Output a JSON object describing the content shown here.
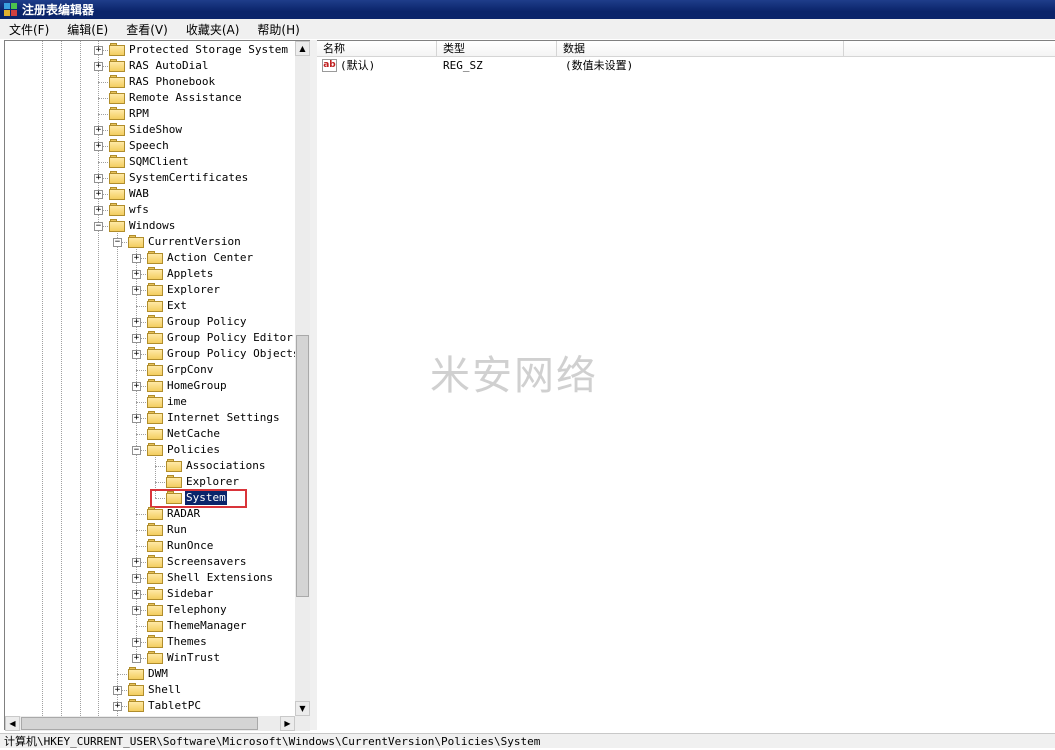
{
  "window": {
    "title": "注册表编辑器"
  },
  "menu": [
    "文件(F)",
    "编辑(E)",
    "查看(V)",
    "收藏夹(A)",
    "帮助(H)"
  ],
  "tree": [
    {
      "label": "Protected Storage System Pro",
      "level": 0,
      "expander": "+"
    },
    {
      "label": "RAS AutoDial",
      "level": 0,
      "expander": "+"
    },
    {
      "label": "RAS Phonebook",
      "level": 0,
      "expander": ""
    },
    {
      "label": "Remote Assistance",
      "level": 0,
      "expander": ""
    },
    {
      "label": "RPM",
      "level": 0,
      "expander": ""
    },
    {
      "label": "SideShow",
      "level": 0,
      "expander": "+"
    },
    {
      "label": "Speech",
      "level": 0,
      "expander": "+"
    },
    {
      "label": "SQMClient",
      "level": 0,
      "expander": ""
    },
    {
      "label": "SystemCertificates",
      "level": 0,
      "expander": "+"
    },
    {
      "label": "WAB",
      "level": 0,
      "expander": "+"
    },
    {
      "label": "wfs",
      "level": 0,
      "expander": "+"
    },
    {
      "label": "Windows",
      "level": 0,
      "expander": "-"
    },
    {
      "label": "CurrentVersion",
      "level": 1,
      "expander": "-"
    },
    {
      "label": "Action Center",
      "level": 2,
      "expander": "+"
    },
    {
      "label": "Applets",
      "level": 2,
      "expander": "+"
    },
    {
      "label": "Explorer",
      "level": 2,
      "expander": "+"
    },
    {
      "label": "Ext",
      "level": 2,
      "expander": ""
    },
    {
      "label": "Group Policy",
      "level": 2,
      "expander": "+"
    },
    {
      "label": "Group Policy Editor",
      "level": 2,
      "expander": "+"
    },
    {
      "label": "Group Policy Objects",
      "level": 2,
      "expander": "+"
    },
    {
      "label": "GrpConv",
      "level": 2,
      "expander": ""
    },
    {
      "label": "HomeGroup",
      "level": 2,
      "expander": "+"
    },
    {
      "label": "ime",
      "level": 2,
      "expander": ""
    },
    {
      "label": "Internet Settings",
      "level": 2,
      "expander": "+"
    },
    {
      "label": "NetCache",
      "level": 2,
      "expander": ""
    },
    {
      "label": "Policies",
      "level": 2,
      "expander": "-"
    },
    {
      "label": "Associations",
      "level": 3,
      "expander": ""
    },
    {
      "label": "Explorer",
      "level": 3,
      "expander": ""
    },
    {
      "label": "System",
      "level": 3,
      "expander": "",
      "selected": true
    },
    {
      "label": "RADAR",
      "level": 2,
      "expander": ""
    },
    {
      "label": "Run",
      "level": 2,
      "expander": ""
    },
    {
      "label": "RunOnce",
      "level": 2,
      "expander": ""
    },
    {
      "label": "Screensavers",
      "level": 2,
      "expander": "+"
    },
    {
      "label": "Shell Extensions",
      "level": 2,
      "expander": "+"
    },
    {
      "label": "Sidebar",
      "level": 2,
      "expander": "+"
    },
    {
      "label": "Telephony",
      "level": 2,
      "expander": "+"
    },
    {
      "label": "ThemeManager",
      "level": 2,
      "expander": ""
    },
    {
      "label": "Themes",
      "level": 2,
      "expander": "+"
    },
    {
      "label": "WinTrust",
      "level": 2,
      "expander": "+"
    },
    {
      "label": "DWM",
      "level": 1,
      "expander": ""
    },
    {
      "label": "Shell",
      "level": 1,
      "expander": "+"
    },
    {
      "label": "TabletPC",
      "level": 1,
      "expander": "+"
    }
  ],
  "list": {
    "columns": [
      "名称",
      "类型",
      "数据"
    ],
    "rows": [
      {
        "name": "(默认)",
        "type": "REG_SZ",
        "data": "(数值未设置)",
        "icon": "string-value-icon"
      }
    ]
  },
  "watermark": "米安网络",
  "status": {
    "path": "计算机\\HKEY_CURRENT_USER\\Software\\Microsoft\\Windows\\CurrentVersion\\Policies\\System"
  },
  "colors": {
    "titlebar": "#0a246a",
    "selection": "#0a246a",
    "highlight_box": "#d9343a"
  }
}
